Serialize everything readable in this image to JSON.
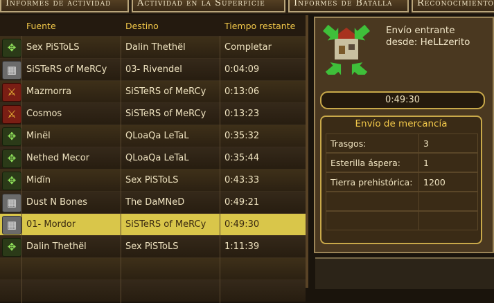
{
  "tabs": [
    {
      "label": "Informes de actividad"
    },
    {
      "label": "Actividad en la Superficie"
    },
    {
      "label": "Informes de Batalla"
    },
    {
      "label": "Reconocimientos"
    }
  ],
  "table": {
    "headers": {
      "source": "Fuente",
      "destination": "Destino",
      "time": "Tiempo restante"
    },
    "rows": [
      {
        "icon": "move-arrows-icon",
        "source": "Sex PiSToLS",
        "destination": "Dalin Thethël",
        "time": "Completar"
      },
      {
        "icon": "cart-icon",
        "source": "SiSTeRS of MeRCy",
        "destination": "03- Rivendel",
        "time": "0:04:09"
      },
      {
        "icon": "attack-icon",
        "source": "Mazmorra",
        "destination": "SiSTeRS of MeRCy",
        "time": "0:13:06"
      },
      {
        "icon": "attack-icon",
        "source": "Cosmos",
        "destination": "SiSTeRS of MeRCy",
        "time": "0:13:23"
      },
      {
        "icon": "move-arrows-icon",
        "source": "Minël",
        "destination": "QLoaQa LeTaL",
        "time": "0:35:32"
      },
      {
        "icon": "move-arrows-icon",
        "source": "Nethed Mecor",
        "destination": "QLoaQa LeTaL",
        "time": "0:35:44"
      },
      {
        "icon": "move-arrows-icon",
        "source": "Midïn",
        "destination": "Sex PiSToLS",
        "time": "0:43:33"
      },
      {
        "icon": "cart-icon",
        "source": "Dust N Bones",
        "destination": "The DaMNeD",
        "time": "0:49:21"
      },
      {
        "icon": "cart-icon",
        "source": "01- Mordor",
        "destination": "SiSTeRS of MeRCy",
        "time": "0:49:30"
      },
      {
        "icon": "move-arrows-icon",
        "source": "Dalin Thethël",
        "destination": "Sex PiSToLS",
        "time": "1:11:39"
      }
    ]
  },
  "detail": {
    "heading_line1": "Envío entrante",
    "heading_line2": "desde: HeLLzerito",
    "timer": "0:49:30",
    "cargo_title": "Envío de mercancía",
    "cargo": [
      {
        "name": "Trasgos:",
        "value": "3"
      },
      {
        "name": "Esterilla áspera:",
        "value": "1"
      },
      {
        "name": "Tierra prehistórica:",
        "value": "1200"
      }
    ]
  },
  "colors": {
    "header": "#f3c94a",
    "selected_row": "#d9c64a",
    "text": "#efe3c0"
  }
}
